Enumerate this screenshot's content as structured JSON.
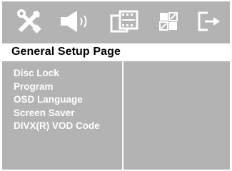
{
  "tabs": [
    {
      "icon": "tools-icon",
      "active": true
    },
    {
      "icon": "speaker-icon",
      "active": false
    },
    {
      "icon": "film-icon",
      "active": false
    },
    {
      "icon": "preferences-grid-icon",
      "active": false
    },
    {
      "icon": "exit-icon",
      "active": false
    }
  ],
  "header": {
    "title": "General Setup Page"
  },
  "menu": {
    "items": [
      {
        "label": "Disc Lock"
      },
      {
        "label": "Program"
      },
      {
        "label": "OSD Language"
      },
      {
        "label": "Screen Saver"
      },
      {
        "label": "DIVX(R) VOD Code"
      }
    ]
  },
  "colors": {
    "panel": "#b3b3b3",
    "text": "#ffffff",
    "header_bg": "#ffffff",
    "header_text": "#000000"
  }
}
